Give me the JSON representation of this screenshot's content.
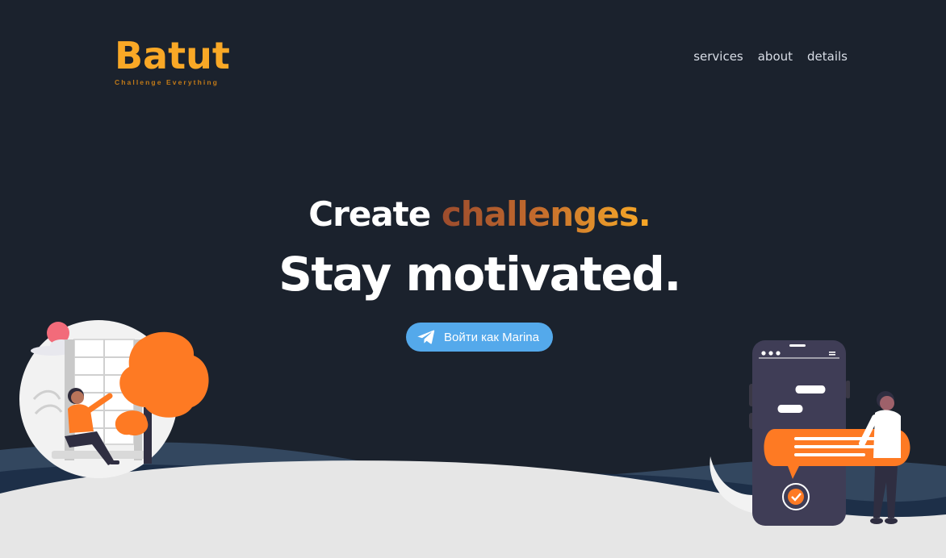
{
  "brand": {
    "name": "Batut",
    "tagline": "Challenge Everything",
    "color": "#f9a826"
  },
  "nav": {
    "items": [
      {
        "label": "services"
      },
      {
        "label": "about"
      },
      {
        "label": "details"
      }
    ]
  },
  "hero": {
    "line1_prefix": "Create",
    "line1_accent": "challenges.",
    "line2": "Stay motivated."
  },
  "login": {
    "label": "Войти как Marina",
    "icon": "telegram-icon",
    "color": "#54a9eb"
  },
  "colors": {
    "background": "#1b222d",
    "ground": "#e6e6e6",
    "wave": "#3a5068",
    "accent": "#fe7a23"
  }
}
